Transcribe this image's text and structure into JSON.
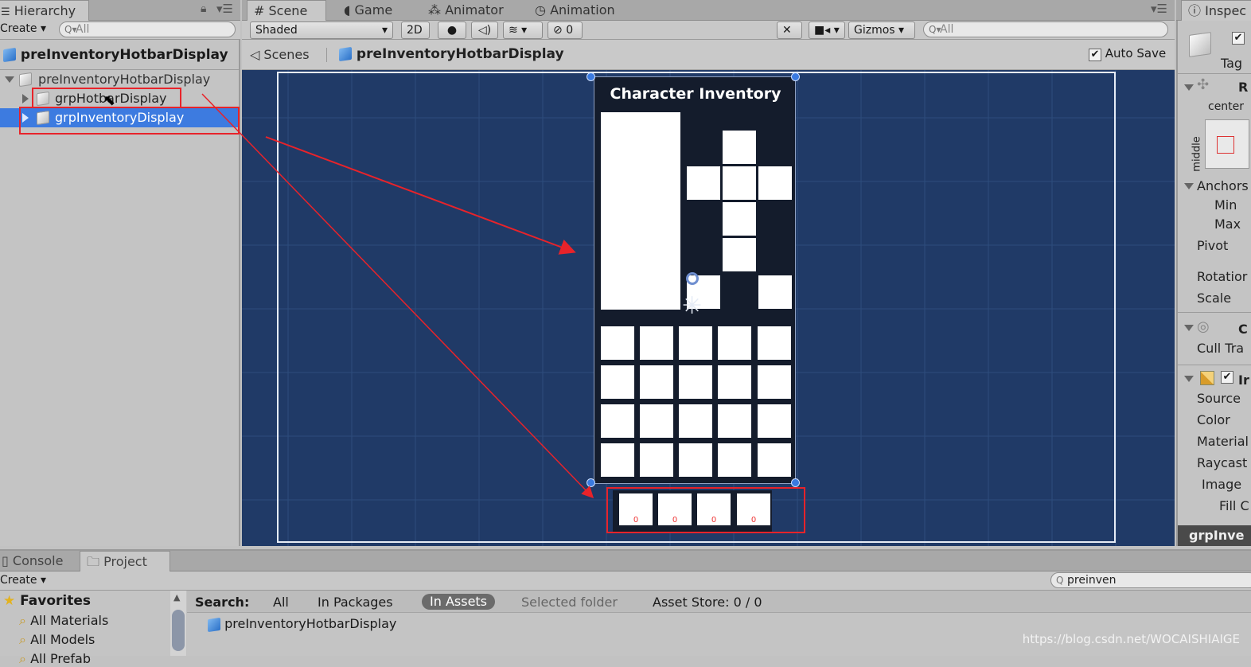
{
  "hierarchy": {
    "tab_title": "Hierarchy",
    "create_label": "Create",
    "search_placeholder": "All",
    "header_title": "preInventoryHotbarDisplay",
    "root": "preInventoryHotbarDisplay",
    "children": [
      "grpHotbarDisplay",
      "grpInventoryDisplay"
    ]
  },
  "scene_tabs": [
    "Scene",
    "Game",
    "Animator",
    "Animation"
  ],
  "scene_toolbar": {
    "shading": "Shaded",
    "mode_2d": "2D",
    "hidden_count": "0",
    "gizmos": "Gizmos",
    "search_placeholder": "All"
  },
  "breadcrumb": {
    "scenes": "Scenes",
    "prefab": "preInventoryHotbarDisplay",
    "auto_save": "Auto Save"
  },
  "canvas": {
    "title": "Character Inventory",
    "hotbar_counts": [
      "0",
      "0",
      "0",
      "0"
    ]
  },
  "inspector": {
    "tab_title": "Inspec",
    "tag": "Tag",
    "rect_header": "R",
    "center": "center",
    "middle": "middle",
    "anchors": "Anchors",
    "min": "Min",
    "max": "Max",
    "pivot": "Pivot",
    "rotation": "Rotatior",
    "scale": "Scale",
    "canvas_renderer": "C",
    "cull": "Cull Tra",
    "image_header": "Ir",
    "source": "Source",
    "color": "Color",
    "material": "Material",
    "raycast": "Raycast",
    "image": "Image",
    "fill": "Fill C",
    "footer": "grpInve"
  },
  "bottom": {
    "console": "Console",
    "project": "Project",
    "create_label": "Create",
    "search_value": "preinven",
    "favorites": "Favorites",
    "fav_items": [
      "All Materials",
      "All Models",
      "All Prefab"
    ],
    "search_label": "Search:",
    "filters": [
      "All",
      "In Packages",
      "In Assets",
      "Selected folder"
    ],
    "asset_store": "Asset Store: 0 / 0",
    "result": "preInventoryHotbarDisplay"
  },
  "watermark": "https://blog.csdn.net/WOCAISHIAIGE"
}
